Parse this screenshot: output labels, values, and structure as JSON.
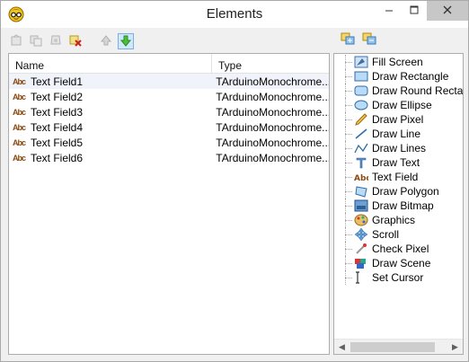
{
  "window": {
    "title": "Elements",
    "app_icon": "face-with-glasses-icon"
  },
  "toolbar": {
    "buttons": [
      {
        "icon": "add-element-disabled-icon"
      },
      {
        "icon": "copy-element-disabled-icon"
      },
      {
        "icon": "properties-disabled-icon"
      },
      {
        "icon": "delete-element-icon"
      },
      {
        "icon": "move-up-icon"
      },
      {
        "icon": "move-down-icon"
      }
    ],
    "right_buttons": [
      {
        "icon": "expand-all-icon"
      },
      {
        "icon": "collapse-all-icon"
      }
    ]
  },
  "list": {
    "columns": [
      "Name",
      "Type"
    ],
    "rows": [
      {
        "name": "Text Field1",
        "type": "TArduinoMonochrome..."
      },
      {
        "name": "Text Field2",
        "type": "TArduinoMonochrome..."
      },
      {
        "name": "Text Field3",
        "type": "TArduinoMonochrome..."
      },
      {
        "name": "Text Field4",
        "type": "TArduinoMonochrome..."
      },
      {
        "name": "Text Field5",
        "type": "TArduinoMonochrome..."
      },
      {
        "name": "Text Field6",
        "type": "TArduinoMonochrome..."
      }
    ],
    "row_icon_text": "Abc"
  },
  "tools": [
    {
      "label": "Fill Screen",
      "icon": "fill-screen-icon"
    },
    {
      "label": "Draw Rectangle",
      "icon": "rectangle-icon"
    },
    {
      "label": "Draw Round Rectang",
      "icon": "round-rectangle-icon"
    },
    {
      "label": "Draw Ellipse",
      "icon": "ellipse-icon"
    },
    {
      "label": "Draw Pixel",
      "icon": "pencil-icon"
    },
    {
      "label": "Draw Line",
      "icon": "line-icon"
    },
    {
      "label": "Draw Lines",
      "icon": "lines-icon"
    },
    {
      "label": "Draw Text",
      "icon": "text-icon"
    },
    {
      "label": "Text Field",
      "icon": "text-field-icon"
    },
    {
      "label": "Draw Polygon",
      "icon": "polygon-icon"
    },
    {
      "label": "Draw Bitmap",
      "icon": "bitmap-icon"
    },
    {
      "label": "Graphics",
      "icon": "graphics-icon"
    },
    {
      "label": "Scroll",
      "icon": "scroll-arrows-icon"
    },
    {
      "label": "Check Pixel",
      "icon": "check-pixel-icon"
    },
    {
      "label": "Draw Scene",
      "icon": "scene-icon"
    },
    {
      "label": "Set Cursor",
      "icon": "cursor-icon"
    }
  ]
}
